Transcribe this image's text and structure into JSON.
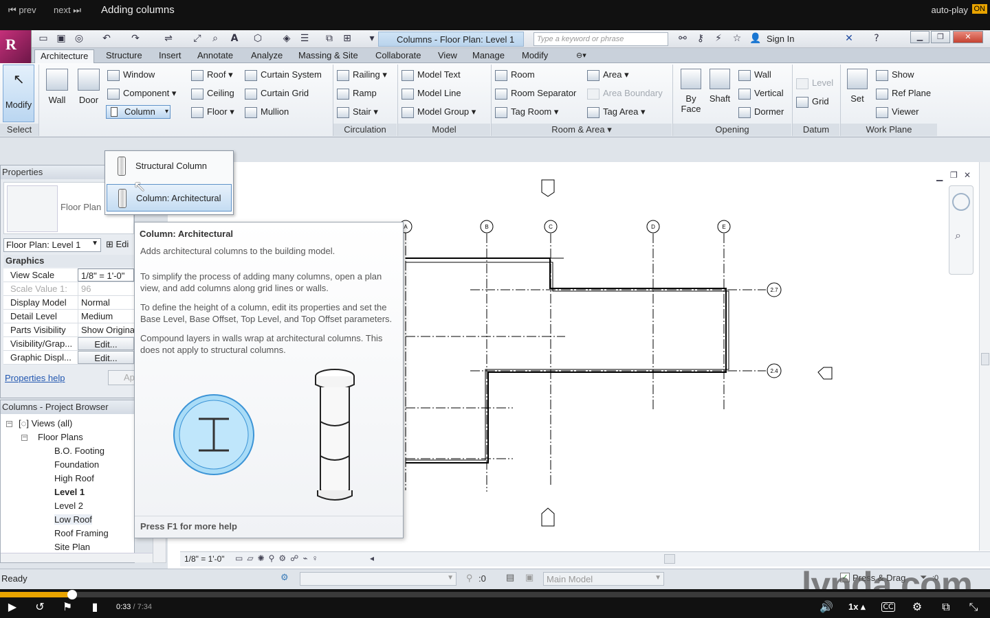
{
  "player": {
    "prev_label": "prev",
    "next_label": "next",
    "video_title": "Adding columns",
    "autoplay_label": "auto-play",
    "autoplay_state": "ON",
    "current_time": "0:33",
    "duration": "7:34",
    "progress_fraction": 0.0727,
    "speed": "1x",
    "accent_color": "#e8a300"
  },
  "qat": {
    "document_title": "Columns - Floor Plan: Level 1",
    "search_placeholder": "Type a keyword or phrase",
    "sign_in": "Sign In"
  },
  "tabs": [
    "Architecture",
    "Structure",
    "Insert",
    "Annotate",
    "Analyze",
    "Massing & Site",
    "Collaborate",
    "View",
    "Manage",
    "Modify"
  ],
  "ribbon": {
    "select": {
      "modify": "Modify",
      "panel": "Select"
    },
    "build": {
      "wall": "Wall",
      "door": "Door",
      "window": "Window",
      "component": "Component",
      "column": "Column",
      "roof": "Roof",
      "ceiling": "Ceiling",
      "floor": "Floor",
      "curtain_system": "Curtain System",
      "curtain_grid": "Curtain Grid",
      "mullion": "Mullion"
    },
    "circulation": {
      "railing": "Railing",
      "ramp": "Ramp",
      "stair": "Stair",
      "panel": "Circulation"
    },
    "model": {
      "model_text": "Model Text",
      "model_line": "Model Line",
      "model_group": "Model Group",
      "panel": "Model"
    },
    "room_area": {
      "room": "Room",
      "room_separator": "Room Separator",
      "tag_room": "Tag Room",
      "area": "Area",
      "area_boundary": "Area Boundary",
      "tag_area": "Tag Area",
      "panel": "Room & Area"
    },
    "opening": {
      "by_face_1": "By",
      "by_face_2": "Face",
      "shaft": "Shaft",
      "wall": "Wall",
      "vertical": "Vertical",
      "dormer": "Dormer",
      "panel": "Opening"
    },
    "datum": {
      "level": "Level",
      "grid": "Grid",
      "panel": "Datum"
    },
    "work_plane": {
      "set": "Set",
      "show": "Show",
      "ref_plane": "Ref Plane",
      "viewer": "Viewer",
      "panel": "Work Plane"
    }
  },
  "column_dropdown": {
    "items": [
      "Structural Column",
      "Column: Architectural"
    ]
  },
  "tooltip": {
    "title": "Column: Architectural",
    "summary": "Adds architectural columns to the building model.",
    "p1": "To simplify the process of adding many columns, open a plan view, and add columns along grid lines or walls.",
    "p2": "To define the height of a column, edit its properties and set the Base Level, Base Offset, Top Level, and Top Offset parameters.",
    "p3": "Compound layers in walls wrap at architectural columns. This does not apply to structural columns.",
    "footer": "Press F1 for more help"
  },
  "properties": {
    "header": "Properties",
    "type_label": "Floor Plan",
    "instance_select": "Floor Plan: Level 1",
    "edit_type": "Edi",
    "group": "Graphics",
    "rows": [
      {
        "key": "View Scale",
        "value": "1/8\" = 1'-0\""
      },
      {
        "key": "Scale Value    1:",
        "value": "96"
      },
      {
        "key": "Display Model",
        "value": "Normal"
      },
      {
        "key": "Detail Level",
        "value": "Medium"
      },
      {
        "key": "Parts Visibility",
        "value": "Show Origina"
      },
      {
        "key": "Visibility/Grap...",
        "value": "Edit..."
      },
      {
        "key": "Graphic Displ...",
        "value": "Edit..."
      }
    ],
    "help_link": "Properties help",
    "apply": "Ap"
  },
  "browser": {
    "header": "Columns - Project Browser",
    "views": "Views (all)",
    "floor_plans": "Floor Plans",
    "items": [
      "B.O. Footing",
      "Foundation",
      "High Roof",
      "Level 1",
      "Level 2",
      "Low Roof",
      "Roof Framing",
      "Site Plan"
    ]
  },
  "grid_bubbles": [
    "A",
    "B",
    "C",
    "D",
    "E",
    "2.7",
    "2.4"
  ],
  "view_bar": {
    "scale": "1/8\" = 1'-0\""
  },
  "status": {
    "ready": "Ready",
    "zero": ":0",
    "main_model": "Main Model",
    "press_drag": "Press & Drag",
    "filter_count": ":0"
  },
  "watermark": "lynda.com"
}
